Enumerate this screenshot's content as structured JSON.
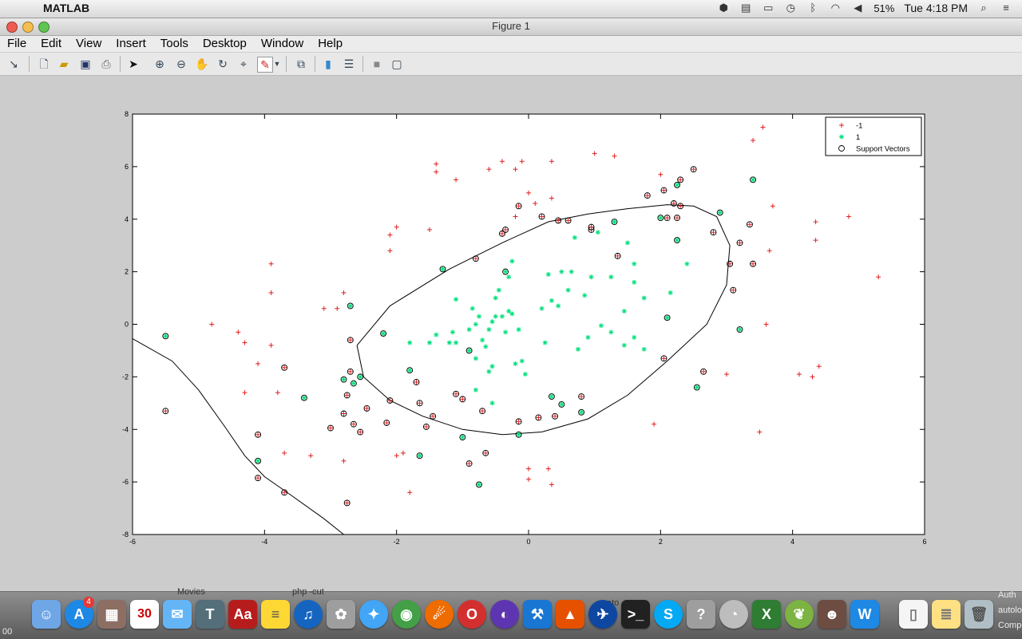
{
  "menubar": {
    "app_name": "MATLAB",
    "battery": "51%",
    "clock": "Tue 4:18 PM"
  },
  "window": {
    "title": "Figure 1",
    "menus": [
      "File",
      "Edit",
      "View",
      "Insert",
      "Tools",
      "Desktop",
      "Window",
      "Help"
    ]
  },
  "toolbar": {
    "icons": [
      "arrow-icon",
      "new-figure-icon",
      "open-icon",
      "save-icon",
      "print-icon",
      "select-icon",
      "zoom-in-icon",
      "zoom-out-icon",
      "pan-icon",
      "rotate-icon",
      "data-cursor-icon",
      "brush-icon",
      "link-icon",
      "colorbar-icon",
      "legend-icon",
      "hide-plot-tools-icon",
      "show-plot-tools-icon"
    ]
  },
  "chart_data": {
    "type": "scatter",
    "title": "",
    "xlabel": "",
    "ylabel": "",
    "xlim": [
      -6,
      6
    ],
    "ylim": [
      -8,
      8
    ],
    "xticks": [
      "-6",
      "-4",
      "-2",
      "0",
      "2",
      "4",
      "6"
    ],
    "yticks": [
      "-8",
      "-6",
      "-4",
      "-2",
      "0",
      "2",
      "4",
      "6",
      "8"
    ],
    "legend": {
      "placement": "top-right",
      "entries": [
        "-1",
        "1",
        "Support Vectors"
      ]
    },
    "colors": {
      "neg": "#e02020",
      "pos": "#00e07a",
      "sv": "#000000",
      "boundary": "#000000"
    },
    "series": [
      {
        "name": "-1",
        "marker": "+",
        "points": [
          [
            -4.3,
            -0.7
          ],
          [
            -4.1,
            -1.5
          ],
          [
            -3.9,
            -0.8
          ],
          [
            -4.8,
            0.0
          ],
          [
            -4.4,
            -0.3
          ],
          [
            -3.8,
            -2.6
          ],
          [
            -4.3,
            -2.6
          ],
          [
            -3.9,
            2.3
          ],
          [
            -3.9,
            1.2
          ],
          [
            -3.7,
            -4.9
          ],
          [
            -3.3,
            -5.0
          ],
          [
            -3.1,
            0.6
          ],
          [
            -2.9,
            0.6
          ],
          [
            -2.8,
            1.2
          ],
          [
            -2.8,
            -5.2
          ],
          [
            -2.1,
            2.8
          ],
          [
            -2.1,
            3.4
          ],
          [
            -2.0,
            3.7
          ],
          [
            -2.0,
            -5.0
          ],
          [
            -1.9,
            -4.9
          ],
          [
            -1.8,
            -6.4
          ],
          [
            -1.5,
            3.6
          ],
          [
            -1.4,
            6.1
          ],
          [
            -1.4,
            5.8
          ],
          [
            -1.1,
            5.5
          ],
          [
            -0.6,
            5.9
          ],
          [
            -0.4,
            6.2
          ],
          [
            -0.2,
            5.9
          ],
          [
            -0.1,
            6.2
          ],
          [
            0.0,
            5.0
          ],
          [
            0.1,
            4.6
          ],
          [
            0.35,
            4.8
          ],
          [
            0.35,
            6.2
          ],
          [
            1.0,
            6.5
          ],
          [
            1.3,
            6.4
          ],
          [
            -0.2,
            4.1
          ],
          [
            0.0,
            -5.5
          ],
          [
            0.3,
            -5.5
          ],
          [
            0.0,
            -5.9
          ],
          [
            0.35,
            -6.1
          ],
          [
            2.0,
            5.7
          ],
          [
            1.9,
            -3.8
          ],
          [
            3.0,
            -1.9
          ],
          [
            3.4,
            7.0
          ],
          [
            3.55,
            7.5
          ],
          [
            3.6,
            0.0
          ],
          [
            3.65,
            2.8
          ],
          [
            3.7,
            4.5
          ],
          [
            3.5,
            -4.1
          ],
          [
            4.1,
            -1.9
          ],
          [
            4.3,
            -2.0
          ],
          [
            4.35,
            3.2
          ],
          [
            4.35,
            3.9
          ],
          [
            4.4,
            -1.6
          ],
          [
            4.85,
            4.1
          ],
          [
            5.3,
            1.8
          ]
        ]
      },
      {
        "name": "1",
        "marker": "*",
        "points": [
          [
            -1.8,
            -0.7
          ],
          [
            -1.5,
            -0.7
          ],
          [
            -1.4,
            -0.4
          ],
          [
            -1.2,
            -0.7
          ],
          [
            -1.15,
            -0.3
          ],
          [
            -1.1,
            -0.7
          ],
          [
            -1.1,
            0.95
          ],
          [
            -0.9,
            -0.2
          ],
          [
            -0.85,
            0.6
          ],
          [
            -0.8,
            0.0
          ],
          [
            -0.75,
            0.3
          ],
          [
            -0.7,
            -0.6
          ],
          [
            -0.65,
            -0.85
          ],
          [
            -0.6,
            -0.2
          ],
          [
            -0.55,
            0.1
          ],
          [
            -0.5,
            1.0
          ],
          [
            -0.5,
            0.3
          ],
          [
            -0.45,
            1.3
          ],
          [
            -0.4,
            0.3
          ],
          [
            -0.35,
            -0.3
          ],
          [
            -0.3,
            0.5
          ],
          [
            -0.3,
            1.8
          ],
          [
            -0.25,
            2.4
          ],
          [
            -0.25,
            0.4
          ],
          [
            -0.2,
            -1.5
          ],
          [
            -0.15,
            -0.2
          ],
          [
            -0.1,
            -1.4
          ],
          [
            -0.05,
            -1.9
          ],
          [
            -0.8,
            -1.3
          ],
          [
            -0.55,
            -1.6
          ],
          [
            -0.6,
            -1.8
          ],
          [
            -0.8,
            -2.5
          ],
          [
            -0.55,
            -3.0
          ],
          [
            0.2,
            0.6
          ],
          [
            0.25,
            -0.7
          ],
          [
            0.3,
            1.9
          ],
          [
            0.35,
            0.9
          ],
          [
            0.45,
            0.7
          ],
          [
            0.5,
            2.0
          ],
          [
            0.6,
            1.3
          ],
          [
            0.65,
            2.0
          ],
          [
            0.7,
            3.3
          ],
          [
            0.75,
            -0.95
          ],
          [
            0.85,
            1.1
          ],
          [
            0.9,
            -0.5
          ],
          [
            0.95,
            1.8
          ],
          [
            1.05,
            3.5
          ],
          [
            1.1,
            -0.05
          ],
          [
            1.25,
            1.8
          ],
          [
            1.25,
            -0.3
          ],
          [
            1.45,
            0.5
          ],
          [
            1.45,
            -0.8
          ],
          [
            1.5,
            3.1
          ],
          [
            1.6,
            1.6
          ],
          [
            1.6,
            -0.5
          ],
          [
            1.6,
            2.3
          ],
          [
            1.75,
            1.0
          ],
          [
            1.75,
            -0.95
          ],
          [
            2.15,
            1.2
          ],
          [
            2.4,
            2.3
          ]
        ]
      },
      {
        "name": "Support Vectors",
        "marker": "o",
        "points": [
          [
            -5.5,
            -0.45
          ],
          [
            -5.5,
            -3.3
          ],
          [
            -4.1,
            -4.2
          ],
          [
            -4.1,
            -5.2
          ],
          [
            -4.1,
            -5.85
          ],
          [
            -3.7,
            -1.65
          ],
          [
            -3.4,
            -2.8
          ],
          [
            -3.7,
            -6.4
          ],
          [
            -3.0,
            -3.95
          ],
          [
            -2.8,
            -2.1
          ],
          [
            -2.8,
            -3.4
          ],
          [
            -2.75,
            -2.7
          ],
          [
            -2.7,
            0.7
          ],
          [
            -2.7,
            -1.8
          ],
          [
            -2.7,
            -0.6
          ],
          [
            -2.65,
            -2.25
          ],
          [
            -2.65,
            -3.8
          ],
          [
            -2.55,
            -4.1
          ],
          [
            -2.55,
            -2.0
          ],
          [
            -2.45,
            -3.2
          ],
          [
            -2.75,
            -6.8
          ],
          [
            -2.2,
            -0.35
          ],
          [
            -2.15,
            -3.75
          ],
          [
            -2.1,
            -2.9
          ],
          [
            -1.8,
            -1.75
          ],
          [
            -1.7,
            -2.2
          ],
          [
            -1.65,
            -3.0
          ],
          [
            -1.65,
            -5.0
          ],
          [
            -1.55,
            -3.9
          ],
          [
            -1.45,
            -3.5
          ],
          [
            -1.3,
            2.1
          ],
          [
            -1.1,
            -2.65
          ],
          [
            -1.0,
            -2.85
          ],
          [
            -1.0,
            -4.3
          ],
          [
            -0.9,
            -5.3
          ],
          [
            -0.8,
            2.5
          ],
          [
            -0.75,
            -6.1
          ],
          [
            -0.65,
            -4.9
          ],
          [
            -0.7,
            -3.3
          ],
          [
            -0.9,
            -1.0
          ],
          [
            -0.4,
            3.45
          ],
          [
            -0.35,
            3.6
          ],
          [
            -0.35,
            2.0
          ],
          [
            -0.15,
            4.5
          ],
          [
            -0.15,
            -3.7
          ],
          [
            -0.15,
            -4.2
          ],
          [
            0.15,
            -3.55
          ],
          [
            0.2,
            4.1
          ],
          [
            0.35,
            -2.75
          ],
          [
            0.4,
            -3.5
          ],
          [
            0.45,
            3.95
          ],
          [
            0.5,
            -3.05
          ],
          [
            0.6,
            3.95
          ],
          [
            0.8,
            -2.75
          ],
          [
            0.8,
            -3.35
          ],
          [
            0.95,
            3.6
          ],
          [
            0.95,
            3.7
          ],
          [
            1.3,
            3.9
          ],
          [
            1.35,
            2.6
          ],
          [
            1.8,
            4.9
          ],
          [
            2.0,
            4.05
          ],
          [
            2.05,
            5.1
          ],
          [
            2.05,
            -1.3
          ],
          [
            2.1,
            0.25
          ],
          [
            2.1,
            4.05
          ],
          [
            2.2,
            4.6
          ],
          [
            2.25,
            5.3
          ],
          [
            2.3,
            5.5
          ],
          [
            2.5,
            5.9
          ],
          [
            2.25,
            3.2
          ],
          [
            2.25,
            4.05
          ],
          [
            2.3,
            4.5
          ],
          [
            2.55,
            -2.4
          ],
          [
            2.65,
            -1.8
          ],
          [
            2.8,
            3.5
          ],
          [
            2.9,
            4.25
          ],
          [
            3.05,
            2.3
          ],
          [
            3.1,
            1.3
          ],
          [
            3.2,
            -0.2
          ],
          [
            3.2,
            3.1
          ],
          [
            3.35,
            3.8
          ],
          [
            3.4,
            5.5
          ],
          [
            3.4,
            2.3
          ]
        ]
      }
    ],
    "boundary_closed": [
      [
        -2.6,
        -0.8
      ],
      [
        -2.1,
        0.7
      ],
      [
        -1.2,
        2.1
      ],
      [
        -0.4,
        3.1
      ],
      [
        0.3,
        3.9
      ],
      [
        0.9,
        4.2
      ],
      [
        1.5,
        4.4
      ],
      [
        2.1,
        4.55
      ],
      [
        2.5,
        4.5
      ],
      [
        2.85,
        4.1
      ],
      [
        3.05,
        3.0
      ],
      [
        3.0,
        1.5
      ],
      [
        2.7,
        0.0
      ],
      [
        2.1,
        -1.4
      ],
      [
        1.5,
        -2.7
      ],
      [
        0.9,
        -3.6
      ],
      [
        0.2,
        -4.1
      ],
      [
        -0.4,
        -4.2
      ],
      [
        -1.0,
        -4.0
      ],
      [
        -1.6,
        -3.5
      ],
      [
        -2.1,
        -2.9
      ],
      [
        -2.5,
        -2.0
      ],
      [
        -2.6,
        -0.8
      ]
    ],
    "boundary_open": [
      [
        -6.0,
        -0.55
      ],
      [
        -5.4,
        -1.4
      ],
      [
        -5.0,
        -2.5
      ],
      [
        -4.6,
        -3.9
      ],
      [
        -4.3,
        -5.0
      ],
      [
        -4.0,
        -5.8
      ],
      [
        -3.6,
        -6.5
      ],
      [
        -3.1,
        -7.4
      ],
      [
        -2.8,
        -8.0
      ]
    ]
  },
  "dock": {
    "badge": "4",
    "calendar_day": "30",
    "snippet_left": "00",
    "snippet_right": [
      "Auth",
      "autolo",
      "Comp"
    ],
    "snippet_mid1": "Movies",
    "snippet_mid2": "php -cut",
    "snippet_mid3": "ato"
  }
}
